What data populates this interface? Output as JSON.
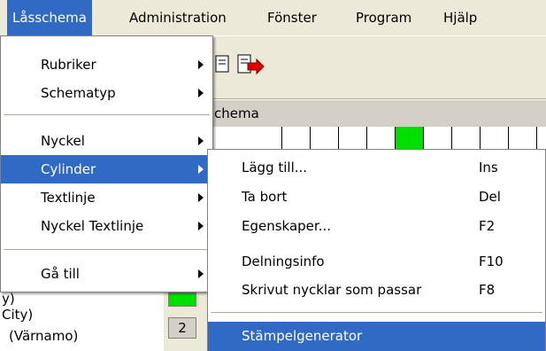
{
  "menubar": {
    "items": [
      "Låsschema",
      "Administration",
      "Fönster",
      "Program",
      "Hjälp"
    ]
  },
  "background": {
    "header_text": "chema",
    "tree_lines": [
      "y)",
      "City)",
      "(Värnamo)"
    ],
    "row_numbers": [
      "2"
    ]
  },
  "menu": {
    "items": [
      {
        "label": "Rubriker"
      },
      {
        "label": "Schematyp"
      },
      {
        "label": "Nyckel"
      },
      {
        "label": "Cylinder"
      },
      {
        "label": "Textlinje"
      },
      {
        "label": "Nyckel Textlinje"
      },
      {
        "label": "Gå till"
      }
    ]
  },
  "submenu": {
    "items": [
      {
        "label": "Lägg till...",
        "shortcut": "Ins"
      },
      {
        "label": "Ta bort",
        "shortcut": "Del"
      },
      {
        "label": "Egenskaper...",
        "shortcut": "F2"
      },
      {
        "label": "Delningsinfo",
        "shortcut": "F10"
      },
      {
        "label": "Skrivut nycklar som passar",
        "shortcut": "F8"
      },
      {
        "label": "Stämpelgenerator",
        "shortcut": ""
      }
    ]
  },
  "colors": {
    "highlight": "#316ac5",
    "menu_bg": "#ffffff",
    "chrome": "#ece9d8",
    "grid_green": "#00e000"
  }
}
